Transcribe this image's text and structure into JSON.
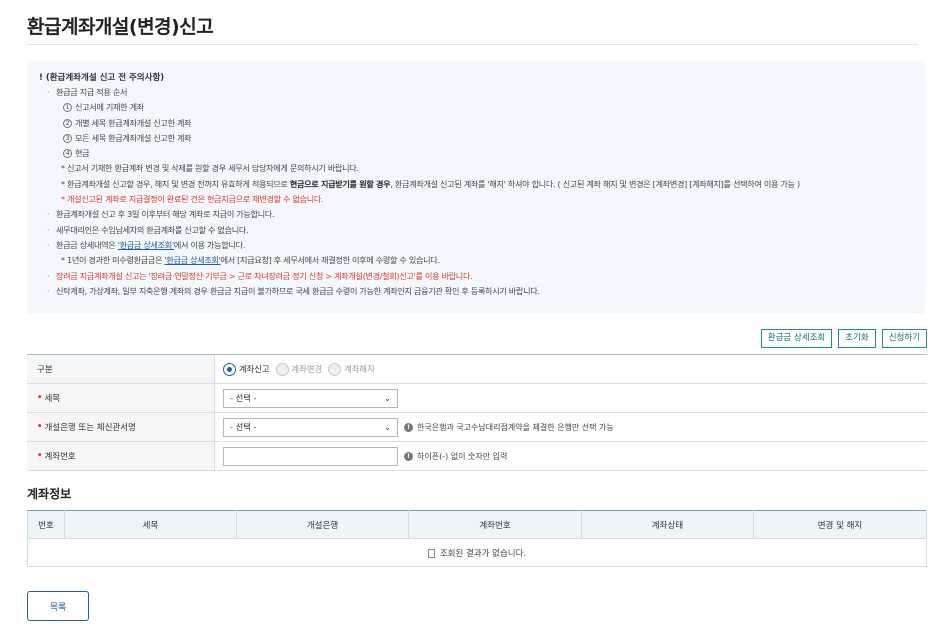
{
  "page": {
    "title": "환급계좌개설(변경)신고"
  },
  "notice": {
    "heading": "! (환급계좌개설 신고 전 주의사항)",
    "order_title": "환급금 지급 적용 순서",
    "order": [
      {
        "num": "1",
        "text": "신고서에 기재한 계좌"
      },
      {
        "num": "2",
        "text": "개별 세목 환급계좌개설 신고한 계좌"
      },
      {
        "num": "3",
        "text": "모든 세목 환급계좌개설 신고한 계좌"
      },
      {
        "num": "4",
        "text": "현금"
      }
    ],
    "star1": "* 신고서 기재한 환급계좌 변경 및 삭제를 원할 경우 세무서 담당자에게 문의하시기 바랍니다.",
    "star2_a": "* 환급계좌개설 신고할 경우, 해지 및 변경 전까지 유효하게 적용되므로 ",
    "star2_b": "현금으로 지급받기를 원할 경우",
    "star2_c": ", 환급계좌개설 신고된 계좌를 '해지' 하셔야 합니다. ( 신고된 계좌 해지 및 변경은 [계좌변경] [계좌해지]를 선택하여 이용 가능 )",
    "star3": "* 개설신고된 계좌로 지급결정이 완료된 건은 현금지급으로 재변경할 수 없습니다.",
    "b2": "환급계좌개설 신고 후 3일 이후부터 해당 계좌로 지급이 가능합니다.",
    "b3": "세무대리인은 수임납세자의 환급계좌를 신고할 수 없습니다.",
    "b4_a": "환급금 상세내역은 ",
    "b4_link": "'환급금 상세조회'",
    "b4_b": "에서 이용 가능합니다.",
    "star4_a": "* 1년이 경과한 미수령환급금은 ",
    "star4_link": "'환급금 상세조회'",
    "star4_b": "에서 [지급요청] 후 세무서에서 재결정한 이후에 수령할 수 있습니다.",
    "b5": "장려금 지급계좌개설 신고는 '장려금·연말정산·기부금 > 근로·자녀장려금 정기 신청 > 계좌개설(변경/철회)신고'를 이용 바랍니다.",
    "b6": "신탁계좌, 가상계좌, 일부 지축은행 계좌의 경우 환급금 지급이 불가하므로 국세 환급금 수령이 가능한 계좌인지 금융기관 확인 후 등록하시기 바랍니다."
  },
  "actions": {
    "refund_detail": "환급금 상세조회",
    "reset": "초기화",
    "apply": "신청하기"
  },
  "form": {
    "type_label": "구분",
    "radios": [
      "계좌신고",
      "계좌변경",
      "계좌해지"
    ],
    "selected_radio": "계좌신고",
    "tax_label": "세목",
    "tax_value": "- 선택 -",
    "bank_label": "개설은행 또는 체신관서명",
    "bank_value": "- 선택 -",
    "bank_hint": "한국은행과 국고수납대리점계약을 체결한 은행만 선택 가능",
    "account_label": "계좌번호",
    "account_value": "",
    "account_hint": "하이픈(-) 없이 숫자만 입력"
  },
  "account_info": {
    "title": "계좌정보",
    "columns": [
      "번호",
      "세목",
      "개설은행",
      "계좌번호",
      "계좌상태",
      "변경 및 해지"
    ],
    "empty_text": "조회된 결과가 없습니다."
  },
  "footer": {
    "list_button": "목록"
  },
  "colors": {
    "accent": "#1a5fb4",
    "teal": "#1e8ba0",
    "required": "#e0352b",
    "notice_bg": "#f4f8fb"
  }
}
